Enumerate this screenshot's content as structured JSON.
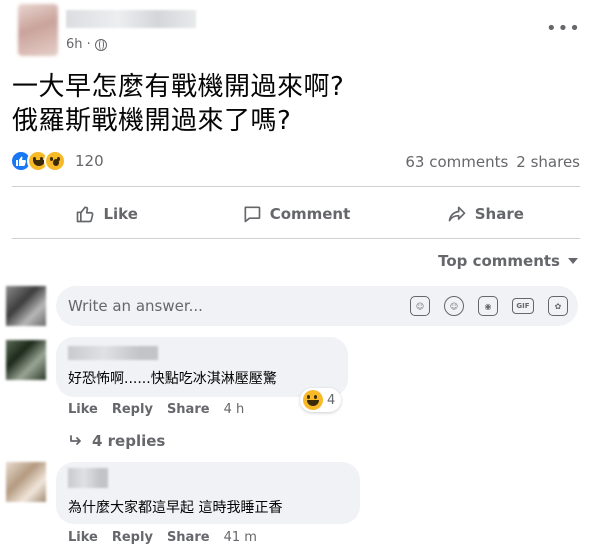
{
  "post": {
    "time": "6h ·",
    "text_line1": "一大早怎麼有戰機開過來啊?",
    "text_line2": "俄羅斯戰機開過來了嗎?",
    "reaction_count": "120",
    "comments_count": "63 comments",
    "shares_count": "2 shares",
    "reaction_icons": [
      "like-icon",
      "haha-icon",
      "wow-icon"
    ],
    "more_icon": "•••"
  },
  "actions": {
    "like_label": "Like",
    "comment_label": "Comment",
    "share_label": "Share"
  },
  "comments_header": {
    "sort_label": "Top comments"
  },
  "composer": {
    "placeholder": "Write an answer...",
    "gif_label": "GIF"
  },
  "comments": [
    {
      "text": "好恐怖啊......快點吃冰淇淋壓壓驚",
      "like_label": "Like",
      "reply_label": "Reply",
      "share_label": "Share",
      "time": "4 h",
      "reaction_count": "4",
      "replies_label": "4 replies"
    },
    {
      "text": "為什麼大家都這早起 這時我睡正香",
      "like_label": "Like",
      "reply_label": "Reply",
      "share_label": "Share",
      "time": "41 m"
    }
  ],
  "colors": {
    "secondary_text": "#65676b",
    "bubble_bg": "#f0f2f5",
    "like_blue": "#1877f2",
    "emoji_yellow": "#f7b928"
  }
}
